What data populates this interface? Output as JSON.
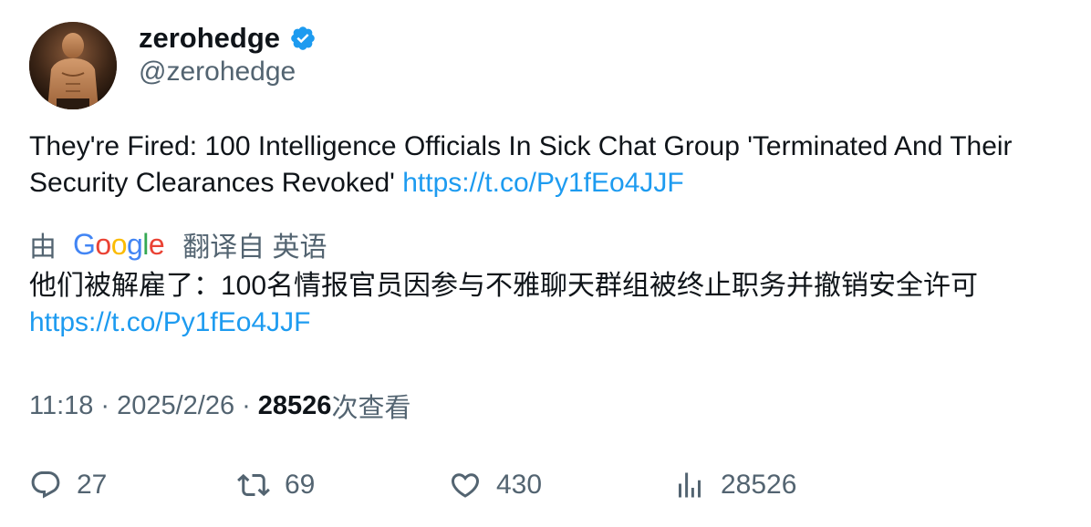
{
  "author": {
    "display_name": "zerohedge",
    "handle": "@zerohedge",
    "verified": true,
    "verified_color": "#1d9bf0"
  },
  "tweet": {
    "text": "They're Fired: 100 Intelligence Officials In Sick Chat Group 'Terminated And Their Security Clearances Revoked' ",
    "link": "https://t.co/Py1fEo4JJF"
  },
  "translation": {
    "by_label": "由",
    "provider": "Google",
    "from_label": "翻译自 英语",
    "text": "他们被解雇了：100名情报官员因参与不雅聊天群组被终止职务并撤销安全许可",
    "link": "https://t.co/Py1fEo4JJF"
  },
  "meta": {
    "time": "11:18",
    "separator": "·",
    "date": "2025/2/26",
    "views_count": "28526",
    "views_label": "次查看"
  },
  "actions": {
    "replies": "27",
    "retweets": "69",
    "likes": "430",
    "views": "28526"
  },
  "icons": {
    "verified": "verified-badge-icon",
    "reply": "reply-icon",
    "retweet": "retweet-icon",
    "like": "heart-icon",
    "views": "bar-chart-icon"
  },
  "colors": {
    "link": "#1d9bf0",
    "secondary_text": "#536471",
    "primary_text": "#0f1419"
  }
}
